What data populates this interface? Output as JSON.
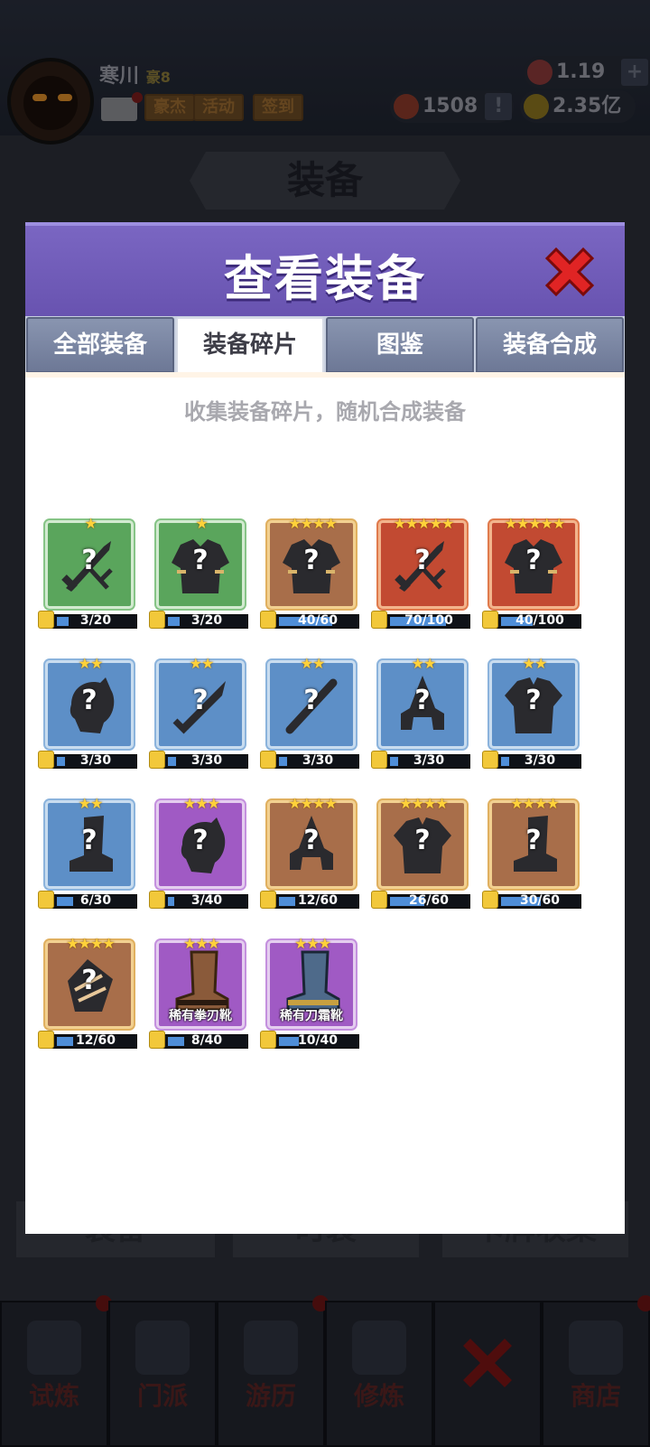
{
  "player": {
    "name": "寒川",
    "vip": "豪8",
    "buttons": [
      "豪杰",
      "活动",
      "签到"
    ]
  },
  "currencies": [
    {
      "name": "gem",
      "value": "1.19万",
      "icon": "gem-icon"
    },
    {
      "name": "token",
      "value": "1508",
      "icon": "token-icon"
    },
    {
      "name": "coin",
      "value": "2.35亿",
      "icon": "coin-icon"
    }
  ],
  "background": {
    "title": "装备",
    "tabs": [
      "装备",
      "时装",
      "卡牌收集"
    ],
    "nav": [
      "试炼",
      "门派",
      "游历",
      "修炼",
      "",
      "商店"
    ]
  },
  "modal": {
    "title": "查看装备",
    "tabs": [
      "全部装备",
      "装备碎片",
      "图鉴",
      "装备合成"
    ],
    "active_tab": 1,
    "subtitle": "收集装备碎片，随机合成装备"
  },
  "colors": {
    "header": "#6853b0",
    "green": "#5aa55c",
    "blue": "#5d8fc7",
    "purple": "#a05ac4",
    "gold": "#a86e4a",
    "red": "#c24a32",
    "progress": "#4f8ed8"
  },
  "items": [
    {
      "rarity": "green",
      "stars": 1,
      "type": "sword",
      "progress": "3/20",
      "fraction": 0.15
    },
    {
      "rarity": "green",
      "stars": 1,
      "type": "armor",
      "progress": "3/20",
      "fraction": 0.15
    },
    {
      "rarity": "gold",
      "stars": 4,
      "type": "armor",
      "progress": "40/60",
      "fraction": 0.67
    },
    {
      "rarity": "red",
      "stars": 5,
      "type": "sword",
      "progress": "70/100",
      "fraction": 0.7
    },
    {
      "rarity": "red",
      "stars": 5,
      "type": "armor",
      "progress": "40/100",
      "fraction": 0.4
    },
    {
      "rarity": "blue",
      "stars": 2,
      "type": "helm",
      "progress": "3/30",
      "fraction": 0.1
    },
    {
      "rarity": "blue",
      "stars": 2,
      "type": "blade",
      "progress": "3/30",
      "fraction": 0.1
    },
    {
      "rarity": "blue",
      "stars": 2,
      "type": "staff",
      "progress": "3/30",
      "fraction": 0.1
    },
    {
      "rarity": "blue",
      "stars": 2,
      "type": "hat",
      "progress": "3/30",
      "fraction": 0.1
    },
    {
      "rarity": "blue",
      "stars": 2,
      "type": "shirt",
      "progress": "3/30",
      "fraction": 0.1
    },
    {
      "rarity": "blue",
      "stars": 2,
      "type": "boot",
      "progress": "6/30",
      "fraction": 0.2
    },
    {
      "rarity": "purple",
      "stars": 3,
      "type": "helm",
      "progress": "3/40",
      "fraction": 0.075
    },
    {
      "rarity": "gold",
      "stars": 4,
      "type": "hat",
      "progress": "12/60",
      "fraction": 0.2
    },
    {
      "rarity": "gold",
      "stars": 4,
      "type": "shirt",
      "progress": "26/60",
      "fraction": 0.43
    },
    {
      "rarity": "gold",
      "stars": 4,
      "type": "boot",
      "progress": "30/60",
      "fraction": 0.5
    },
    {
      "rarity": "gold",
      "stars": 4,
      "type": "glove",
      "progress": "12/60",
      "fraction": 0.2
    },
    {
      "rarity": "purple",
      "stars": 3,
      "type": "real-boot-brown",
      "progress": "8/40",
      "fraction": 0.2,
      "name": "稀有拳刃靴"
    },
    {
      "rarity": "purple",
      "stars": 3,
      "type": "real-boot-blue",
      "progress": "10/40",
      "fraction": 0.25,
      "name": "稀有刀霜靴"
    }
  ]
}
